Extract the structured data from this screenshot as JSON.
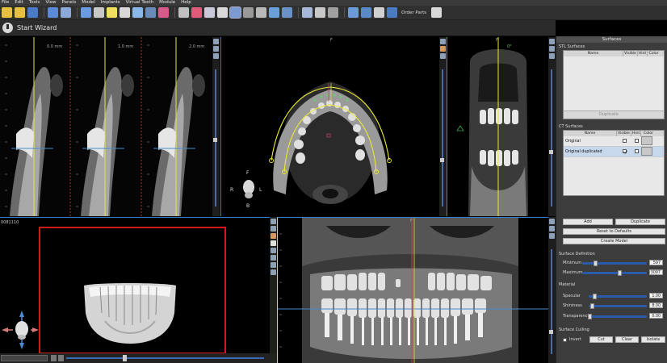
{
  "menu": [
    "File",
    "Edit",
    "Tools",
    "View",
    "Panels",
    "Model",
    "Implants",
    "Virtual Teeth",
    "Module",
    "Help"
  ],
  "toolbar": {
    "order_parts_label": "Order Parts"
  },
  "wizard": {
    "label": "Start Wizard"
  },
  "views": {
    "cross_sections": [
      {
        "label": "0.0 mm",
        "color": "#e8e83a"
      },
      {
        "label": "1.0 mm",
        "color": "#e8e83a"
      },
      {
        "label": "2.0 mm",
        "color": "#e8e83a"
      }
    ],
    "axial": {
      "top_label": "F",
      "orientation": {
        "front": "F",
        "right": "R",
        "left": "L",
        "back": "B"
      }
    },
    "coronal": {
      "top_label": "F",
      "angle_label": "0°"
    },
    "volume": {
      "id_label": "0081110"
    },
    "panoramic": {
      "top_label": "F"
    }
  },
  "panel": {
    "title": "Surfaces",
    "stl": {
      "section": "STL Surfaces",
      "columns": [
        "Name",
        "Visible",
        "Hint",
        "Color"
      ],
      "duplicate_label": "Duplicate"
    },
    "ct": {
      "section": "CT Surfaces",
      "columns": [
        "Name",
        "Visible",
        "Hint",
        "Color"
      ],
      "rows": [
        {
          "name": "Original",
          "visible": false,
          "hint": false
        },
        {
          "name": "Original duplicated",
          "visible": true,
          "hint": false
        }
      ],
      "add_label": "Add",
      "duplicate_label": "Duplicate",
      "reset_label": "Reset to Defaults",
      "create_label": "Create Model"
    },
    "definition": {
      "section": "Surface Definition",
      "minimum_label": "Minimum",
      "minimum_value": "597",
      "minimum_fraction": 0.2,
      "maximum_label": "Maximum",
      "maximum_value": "3097",
      "maximum_fraction": 0.57
    },
    "material": {
      "section": "Material",
      "specular_label": "Specular",
      "specular_value": "1.00",
      "specular_fraction": 0.1,
      "shininess_label": "Shininess",
      "shininess_value": "8.00",
      "shininess_fraction": 0.06,
      "transparency_label": "Transparency",
      "transparency_value": "0.00",
      "transparency_fraction": 0.02
    },
    "culling": {
      "section": "Surface Culling",
      "invert_label": "Invert",
      "cut_label": "Cut",
      "clear_label": "Clear",
      "isolate_label": "Isolate"
    }
  },
  "colors": {
    "slice_line": "#e8e83a",
    "horizontal_line": "#4a8ad0",
    "arch_curve": "#ecec30",
    "bar_selection": "#d01818",
    "panel_bg": "#3c3c3c"
  }
}
